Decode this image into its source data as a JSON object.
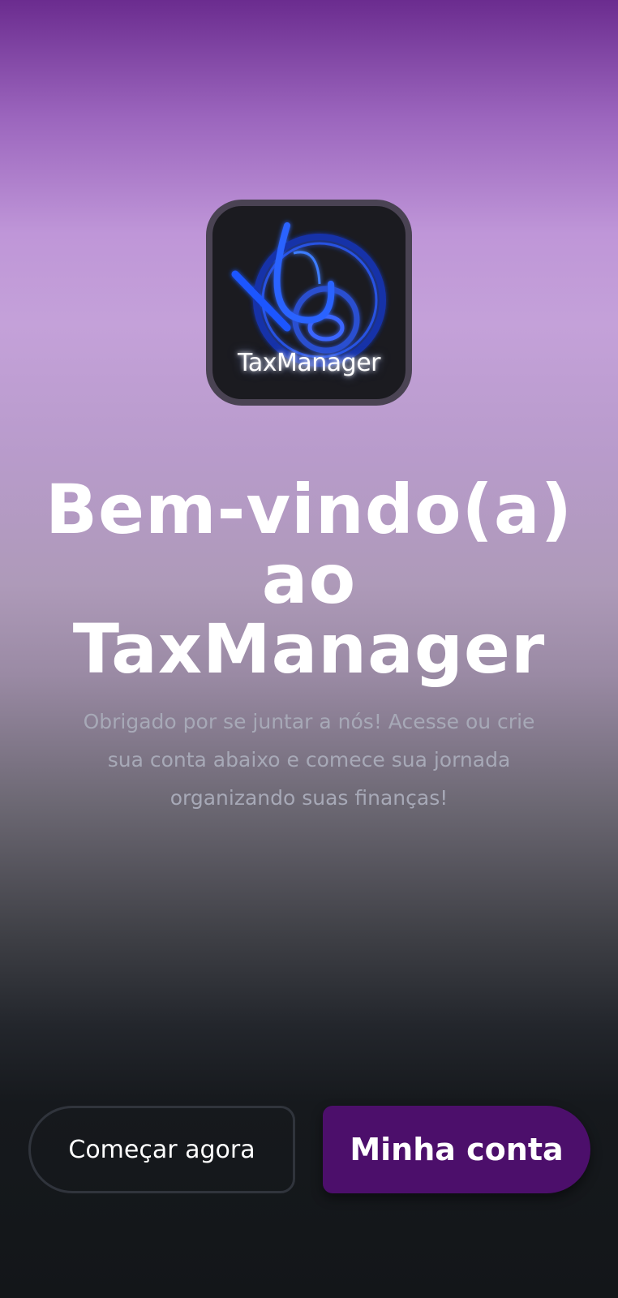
{
  "logo": {
    "icon": "taxmanager-logo-icon",
    "text": "TaxManager"
  },
  "welcome": {
    "title": "Bem-vindo(a) ao TaxManager",
    "subtitle": "Obrigado por se juntar a nós! Acesse ou crie sua conta abaixo e comece sua jornada organizando suas finanças!"
  },
  "actions": {
    "start_label": "Começar agora",
    "account_label": "Minha conta"
  },
  "colors": {
    "primary_button": "#4c0f6b",
    "background_top": "#6b2c8f",
    "background_bottom": "#131619"
  }
}
